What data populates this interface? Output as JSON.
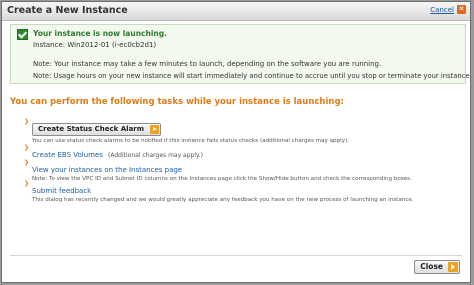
{
  "dialog": {
    "title": "Create a New Instance",
    "cancel_label": "Cancel",
    "cancel_icon": "close-icon"
  },
  "notice": {
    "title": "Your instance is now launching.",
    "instance_line": "Instance:  Win2012-01 (i-ec0cb2d1)",
    "note1": "Note:  Your instance may take a few minutes to launch, depending on the software you are running.",
    "note2": "Note:  Usage hours on your new instance will start immediately and continue to accrue until you stop or terminate your instance."
  },
  "tasks": {
    "heading": "You can perform the following tasks while your instance is launching:",
    "alarm_button": "Create Status Check Alarm",
    "alarm_note": "You can use status check alarms to be notified if this instance fails status checks (additional charges may apply).",
    "ebs_link": "Create EBS Volumes",
    "ebs_note": "(Additional charges may apply.)",
    "instances_link": "View your instances on the Instances page",
    "instances_note": "Note: To view the VPC ID and Subnet ID columns on the Instances page click the Show/Hide button and check the corresponding boxes.",
    "feedback_link": "Submit feedback",
    "feedback_note": "This dialog has recently changed and we would greatly appreciate any feedback you have on the new process of launching an instance."
  },
  "footer": {
    "close_label": "Close"
  },
  "colors": {
    "accent": "#e07b17",
    "link": "#1b5ea8",
    "success": "#2c7a2c"
  }
}
